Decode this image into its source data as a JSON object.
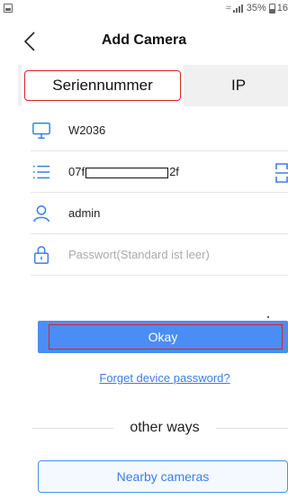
{
  "status_bar": {
    "battery_percent": "35%",
    "time_partial": "16"
  },
  "header": {
    "back_icon": "chevron-left-icon",
    "title": "Add Camera"
  },
  "tabs": [
    {
      "label": "Seriennummer",
      "selected": true
    },
    {
      "label": "IP",
      "selected": false
    }
  ],
  "form": {
    "device_name": {
      "icon": "monitor-icon",
      "value": "W2036"
    },
    "serial": {
      "icon": "list-icon",
      "value_prefix": "07f",
      "value_suffix": "2f",
      "redacted": true,
      "scan_icon": "qr-scan-icon"
    },
    "username": {
      "icon": "user-icon",
      "value": "admin"
    },
    "password": {
      "icon": "lock-icon",
      "placeholder": "Passwort(Standard ist leer)"
    }
  },
  "actions": {
    "okay_label": "Okay",
    "forgot_label": "Forget device password?",
    "other_ways_label": "other ways",
    "nearby_label": "Nearby cameras"
  },
  "colors": {
    "accent": "#4a8ef5",
    "link": "#3b7de9",
    "highlight_outline": "#e0202a"
  }
}
